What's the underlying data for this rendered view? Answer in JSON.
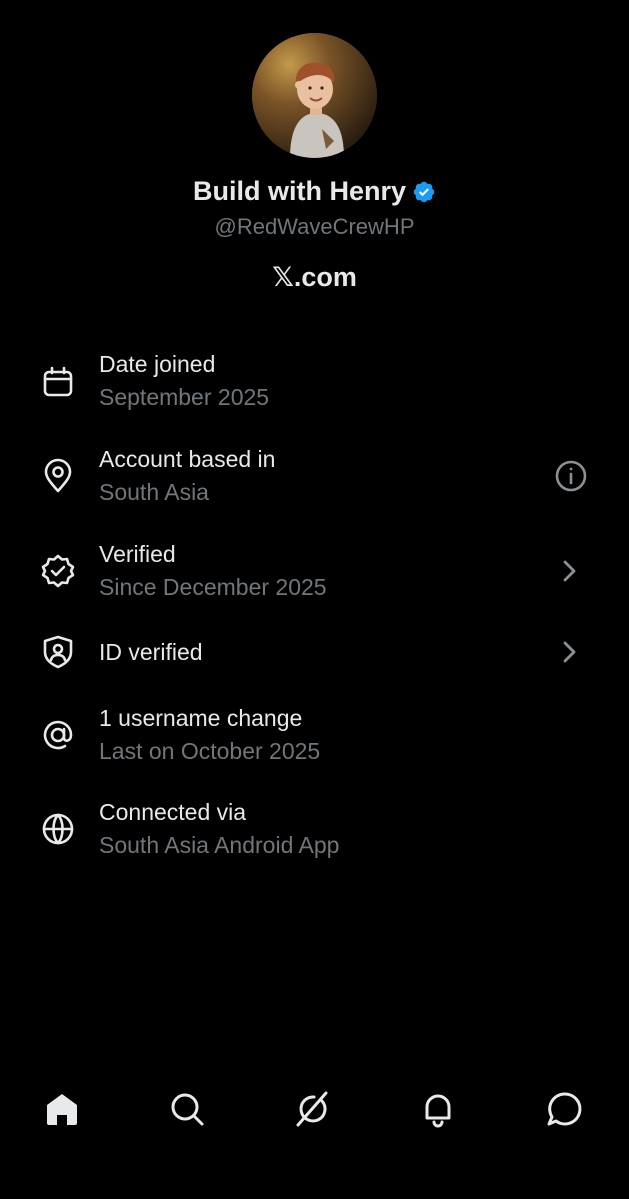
{
  "profile": {
    "display_name": "Build with Henry",
    "handle": "@RedWaveCrewHP",
    "site": "𝕏.com",
    "verified_color": "#1d9bf0"
  },
  "rows": [
    {
      "icon": "calendar-icon",
      "title": "Date joined",
      "subtitle": "September 2025",
      "trailing": ""
    },
    {
      "icon": "location-pin-icon",
      "title": "Account based in",
      "subtitle": "South Asia",
      "trailing": "info-icon"
    },
    {
      "icon": "verified-check-icon",
      "title": "Verified",
      "subtitle": "Since December 2025",
      "trailing": "chevron-right-icon"
    },
    {
      "icon": "id-shield-icon",
      "title": "ID verified",
      "subtitle": "",
      "trailing": "chevron-right-icon"
    },
    {
      "icon": "at-sign-icon",
      "title": "1 username change",
      "subtitle": "Last on October 2025",
      "trailing": ""
    },
    {
      "icon": "globe-icon",
      "title": "Connected via",
      "subtitle": "South Asia Android App",
      "trailing": ""
    }
  ],
  "bottom_nav": [
    "home-icon",
    "search-icon",
    "grok-icon",
    "notifications-icon",
    "messages-icon"
  ],
  "colors": {
    "background": "#000000",
    "primary_text": "#e7e9ea",
    "secondary_text": "#71767b"
  }
}
